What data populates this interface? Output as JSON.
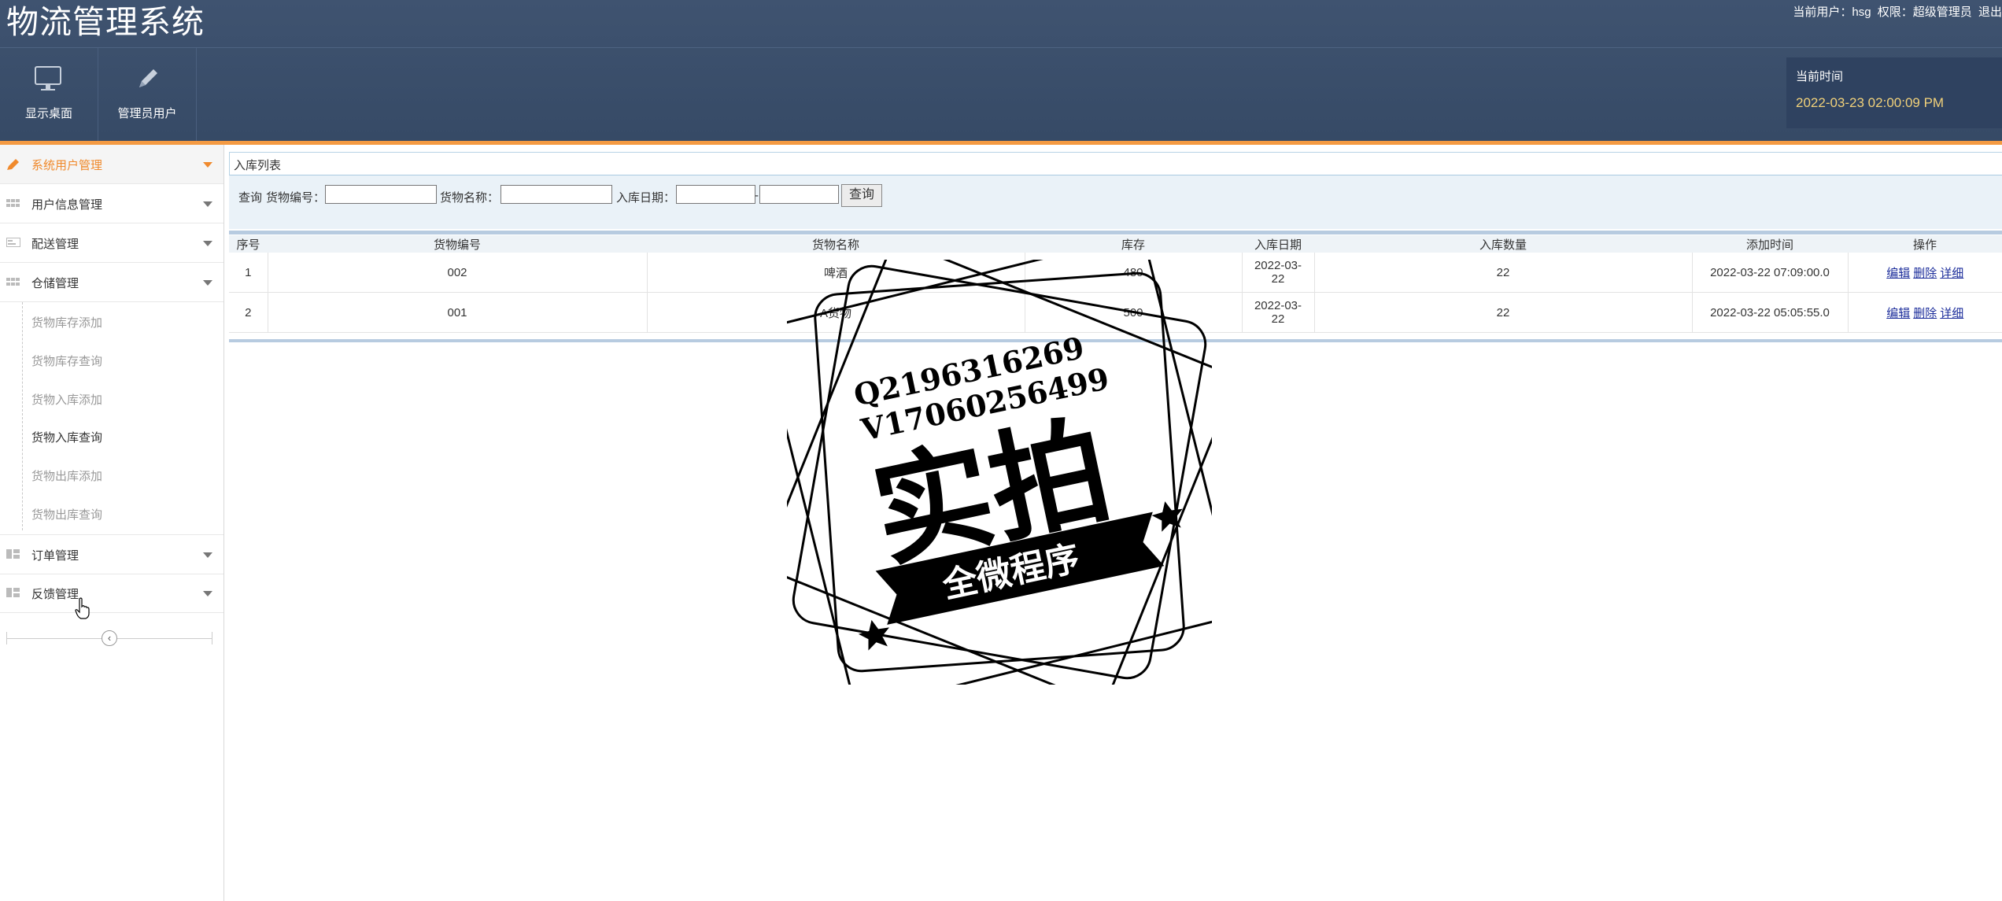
{
  "app": {
    "title": "物流管理系统"
  },
  "user": {
    "current_label": "当前用户：",
    "name": "hsg",
    "role_label": "权限：",
    "role": "超级管理员",
    "logout": "退出"
  },
  "nav": [
    {
      "label": "显示桌面",
      "icon": "monitor-icon"
    },
    {
      "label": "管理员用户",
      "icon": "pencil-icon"
    }
  ],
  "time": {
    "label": "当前时间",
    "value": "2022-03-23 02:00:09 PM"
  },
  "sidebar": {
    "items": [
      {
        "label": "系统用户管理",
        "icon": "pencil-icon",
        "active": true
      },
      {
        "label": "用户信息管理",
        "icon": "grid-icon"
      },
      {
        "label": "配送管理",
        "icon": "card-icon"
      },
      {
        "label": "仓储管理",
        "icon": "grid-icon"
      },
      {
        "label": "订单管理",
        "icon": "layout-icon"
      },
      {
        "label": "反馈管理",
        "icon": "layout-icon"
      }
    ],
    "subitems": [
      "货物库存添加",
      "货物库存查询",
      "货物入库添加",
      "货物入库查询",
      "货物出库添加",
      "货物出库查询"
    ]
  },
  "panel": {
    "title": "入库列表"
  },
  "search": {
    "query_label": "查询",
    "code_label": "货物编号：",
    "name_label": "货物名称：",
    "date_label": "入库日期：",
    "date_sep": "-",
    "button": "查询"
  },
  "table": {
    "headers": [
      "序号",
      "货物编号",
      "货物名称",
      "库存",
      "入库日期",
      "入库数量",
      "添加时间",
      "操作"
    ],
    "rows": [
      {
        "no": "1",
        "code": "002",
        "name": "啤酒",
        "stock": "480",
        "date_line1": "2022-03-",
        "date_line2": "22",
        "qty": "22",
        "added": "2022-03-22 07:09:00.0"
      },
      {
        "no": "2",
        "code": "001",
        "name": "A货物",
        "stock": "500",
        "date_line1": "2022-03-",
        "date_line2": "22",
        "qty": "22",
        "added": "2022-03-22 05:05:55.0"
      }
    ],
    "actions": {
      "edit": "编辑",
      "delete": "删除",
      "detail": "详细"
    }
  },
  "watermark": {
    "line1": "Q2196316269",
    "line2": "V17060256499",
    "main": "实拍",
    "banner": "全微程序"
  }
}
